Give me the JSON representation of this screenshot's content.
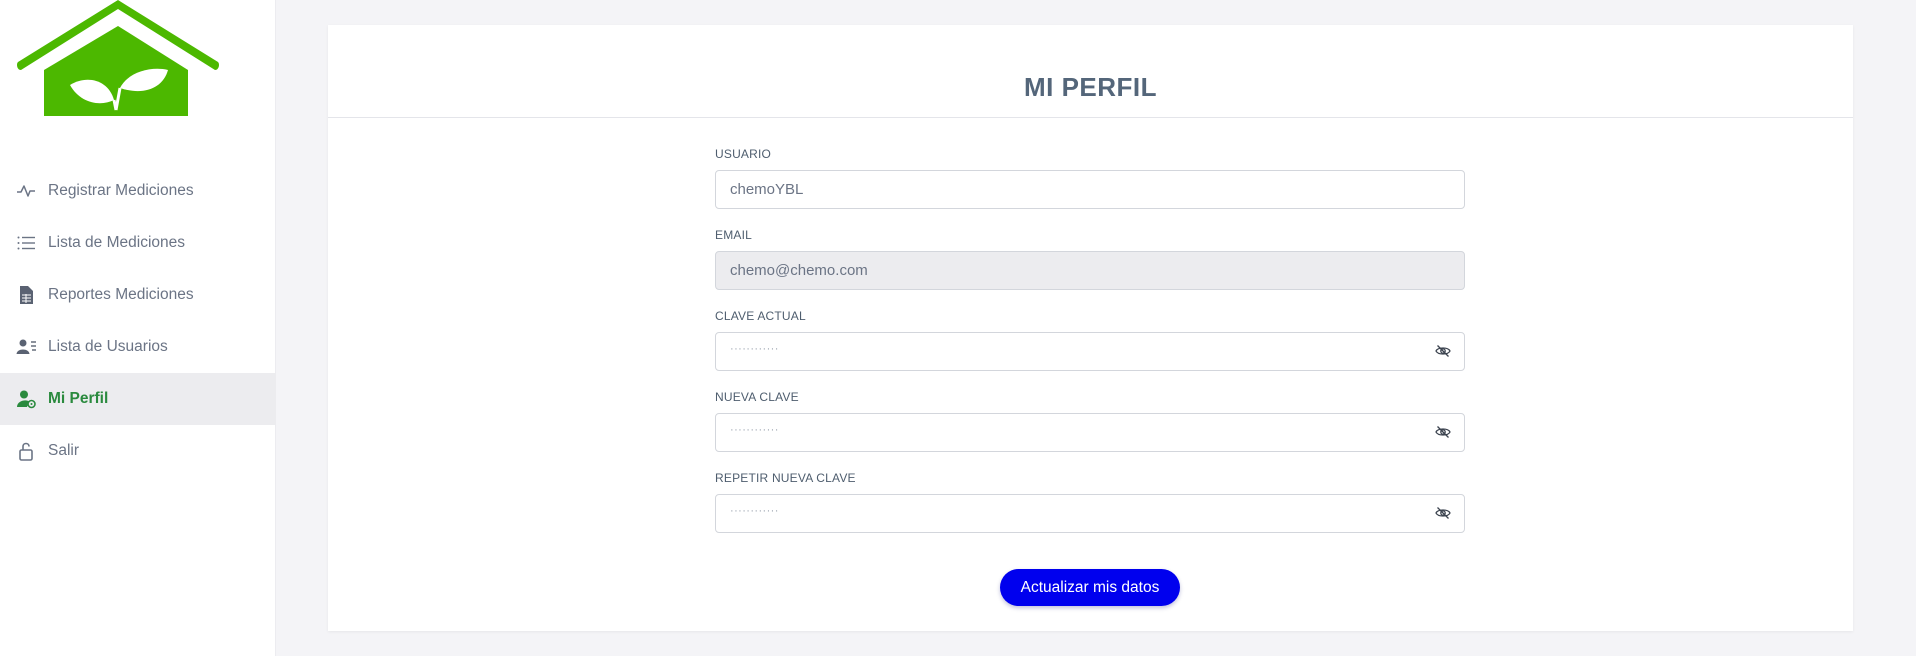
{
  "sidebar": {
    "items": [
      {
        "label": "Registrar Mediciones",
        "icon": "activity-icon"
      },
      {
        "label": "Lista de Mediciones",
        "icon": "list-icon"
      },
      {
        "label": "Reportes Mediciones",
        "icon": "spreadsheet-icon"
      },
      {
        "label": "Lista de Usuarios",
        "icon": "user-list-icon"
      },
      {
        "label": "Mi Perfil",
        "icon": "user-settings-icon",
        "active": true
      },
      {
        "label": "Salir",
        "icon": "unlock-icon"
      }
    ]
  },
  "profile": {
    "title": "MI PERFIL",
    "usuario": {
      "label": "USUARIO",
      "value": "chemoYBL"
    },
    "email": {
      "label": "EMAIL",
      "value": "chemo@chemo.com"
    },
    "clave_actual": {
      "label": "CLAVE ACTUAL",
      "mask": "············"
    },
    "nueva_clave": {
      "label": "NUEVA CLAVE",
      "mask": "············"
    },
    "repetir_clave": {
      "label": "REPETIR NUEVA CLAVE",
      "mask": "············"
    },
    "submit_label": "Actualizar mis datos"
  },
  "colors": {
    "brand_green": "#4cb800",
    "active_green": "#2a8a3e",
    "button_blue": "#0000ee"
  }
}
